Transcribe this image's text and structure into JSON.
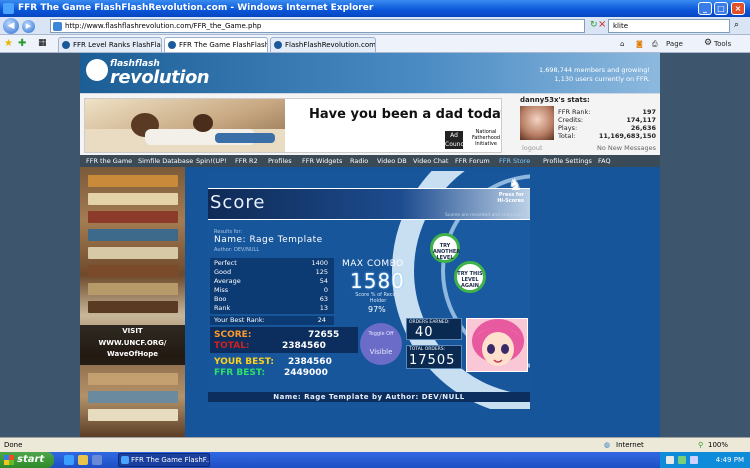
{
  "window": {
    "title": "FFR The Game FlashFlashRevolution.com - Windows Internet Explorer",
    "controls": {
      "minimize": "_",
      "maximize": "□",
      "close": "×"
    }
  },
  "address_bar": {
    "url": "http://www.flashflashrevolution.com/FFR_the_Game.php",
    "search_value": "klite"
  },
  "tabs": [
    {
      "label": "FFR Level Ranks FlashFlashR..."
    },
    {
      "label": "FFR The Game FlashFlashR..."
    },
    {
      "label": "FlashFlashRevolution.com"
    }
  ],
  "toolbar": {
    "page": "Page",
    "tools": "Tools"
  },
  "site": {
    "logo_small": "flashflash",
    "logo_big": "revolution",
    "members_line": "1,698,744 members and growing!",
    "online_line": "1,130 users currently on FFR."
  },
  "ad": {
    "headline": "Have you been a dad today?",
    "badge1": "Ad Council",
    "badge2": "National Fatherhood Initiative"
  },
  "userbox": {
    "header": "danny53x's stats:",
    "rows": [
      {
        "k": "FFR Rank:",
        "v": "197"
      },
      {
        "k": "Credits:",
        "v": "174,117"
      },
      {
        "k": "Plays:",
        "v": "26,636"
      },
      {
        "k": "Total:",
        "v": "11,169,683,150"
      }
    ],
    "logout": "logout",
    "messages": "No New Messages"
  },
  "nav": [
    "FFR the Game",
    "Simfile Database",
    "Spin!(UP!",
    "FFR R2",
    "Profiles",
    "FFR Widgets",
    "Radio",
    "Video DB",
    "Video Chat",
    "FFR Forum",
    "FFR Store",
    "Profile Settings",
    "FAQ"
  ],
  "nav_active_index": 10,
  "left_promo": {
    "line1": "VISIT",
    "line2": "WWW.UNCF.ORG/",
    "line3": "WaveOfHope"
  },
  "game": {
    "title": "Score",
    "press_hs": "Press for\nHi-Scores",
    "record_note": "Scores are recorded and compared",
    "results_for": "Results for:",
    "name": "Name: Rage Template",
    "author": "Author: DEV/NULL",
    "tally": [
      {
        "k": "Perfect",
        "v": "1400"
      },
      {
        "k": "Good",
        "v": "125"
      },
      {
        "k": "Average",
        "v": "54"
      },
      {
        "k": "Miss",
        "v": "0"
      },
      {
        "k": "Boo",
        "v": "63"
      },
      {
        "k": "Rank",
        "v": "13"
      }
    ],
    "best_rank_label": "Your Best Rank:",
    "best_rank_value": "24",
    "max_combo_label": "MAX COMBO",
    "max_combo_value": "1580",
    "combo_note": "Score % of Record Holder",
    "combo_pct": "97%",
    "score_label": "SCORE:",
    "score_value": "72655",
    "total_label": "TOTAL:",
    "total_value": "2384560",
    "your_best_label": "YOUR BEST:",
    "your_best_value": "2384560",
    "ffr_best_label": "FFR BEST:",
    "ffr_best_value": "2449000",
    "ghost_top": "Toggle Off",
    "ghost_bottom": "Visible",
    "orders_label": "ORDERS EARNED:",
    "orders_value": "40",
    "total_orders_label": "TOTAL ORDERS:",
    "total_orders_value": "17505",
    "try_again": "TRY ANOTHER LEVEL",
    "try_this": "TRY THIS LEVEL AGAIN",
    "footer": "Name: Rage Template by Author: DEV/NULL"
  },
  "statusbar": {
    "left": "Done",
    "zone": "Internet",
    "zoom": "100%"
  },
  "taskbar": {
    "start": "start",
    "item": "FFR The Game FlashF...",
    "time": "4:49 PM"
  },
  "colors": {
    "accent": "#17559a",
    "nav": "#3b4a57",
    "score_orange": "#ff9a2a",
    "best_yellow": "#ffd11a",
    "ffr_green": "#2ee06a"
  }
}
